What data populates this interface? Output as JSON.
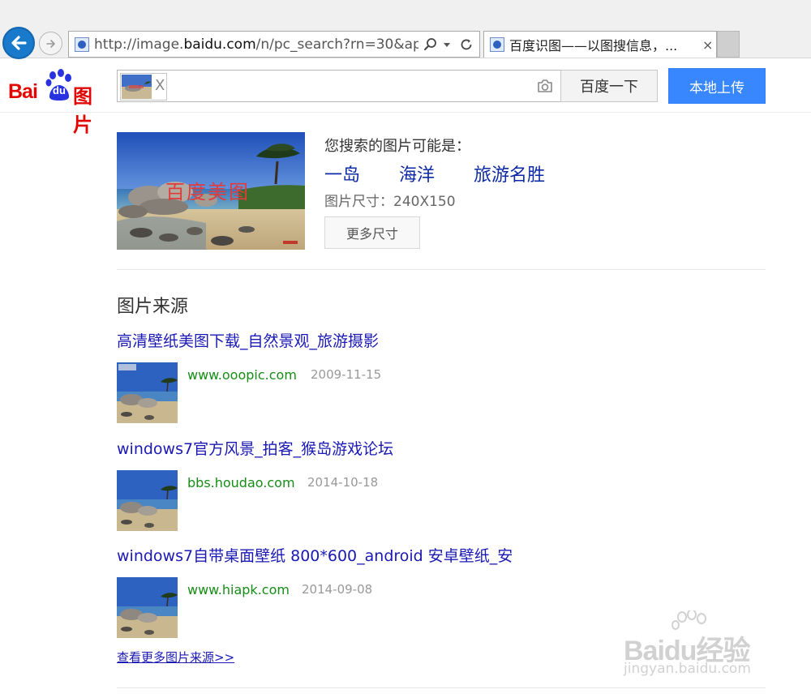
{
  "browser": {
    "url_prefix": "http://image.",
    "url_domain": "baidu.com",
    "url_rest": "/n/pc_search?rn=30&ap",
    "tab_title": "百度识图——以图搜信息，...",
    "tab_close": "×"
  },
  "header": {
    "logo_bai": "Bai",
    "logo_du": "du",
    "logo_pic": "图片",
    "search_thumb_close": "X",
    "search_button": "百度一下",
    "upload_button": "本地上传"
  },
  "result": {
    "image_watermark": "百度美图",
    "guess_label": "您搜索的图片可能是：",
    "tags": [
      "一岛",
      "海洋",
      "旅游名胜"
    ],
    "size_text": "图片尺寸：240X150",
    "more_sizes_button": "更多尺寸"
  },
  "sources": {
    "heading": "图片来源",
    "items": [
      {
        "title": "高清壁纸美图下载_自然景观_旅游摄影",
        "domain": "www.ooopic.com",
        "date": "2009-11-15"
      },
      {
        "title": "windows7官方风景_拍客_猴岛游戏论坛",
        "domain": "bbs.houdao.com",
        "date": "2014-10-18"
      },
      {
        "title": "windows7自带桌面壁纸 800*600_android 安卓壁纸_安",
        "domain": "www.hiapk.com",
        "date": "2014-09-08"
      }
    ],
    "more_link": "查看更多图片来源>>"
  },
  "watermark": {
    "brand": "Baidu经验",
    "url": "jingyan.baidu.com"
  },
  "colors": {
    "baidu_red": "#e10602",
    "upload_blue": "#3887fe",
    "link_blue": "#1a19b5",
    "domain_green": "#168d16"
  }
}
